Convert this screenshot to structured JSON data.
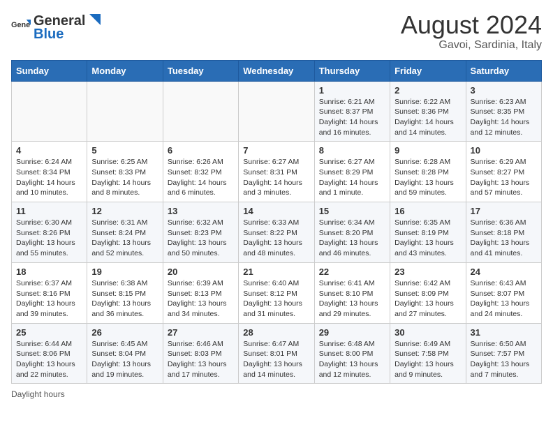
{
  "header": {
    "logo_general": "General",
    "logo_blue": "Blue",
    "main_title": "August 2024",
    "subtitle": "Gavoi, Sardinia, Italy"
  },
  "calendar": {
    "days_of_week": [
      "Sunday",
      "Monday",
      "Tuesday",
      "Wednesday",
      "Thursday",
      "Friday",
      "Saturday"
    ],
    "weeks": [
      [
        {
          "day": "",
          "info": ""
        },
        {
          "day": "",
          "info": ""
        },
        {
          "day": "",
          "info": ""
        },
        {
          "day": "",
          "info": ""
        },
        {
          "day": "1",
          "info": "Sunrise: 6:21 AM\nSunset: 8:37 PM\nDaylight: 14 hours and 16 minutes."
        },
        {
          "day": "2",
          "info": "Sunrise: 6:22 AM\nSunset: 8:36 PM\nDaylight: 14 hours and 14 minutes."
        },
        {
          "day": "3",
          "info": "Sunrise: 6:23 AM\nSunset: 8:35 PM\nDaylight: 14 hours and 12 minutes."
        }
      ],
      [
        {
          "day": "4",
          "info": "Sunrise: 6:24 AM\nSunset: 8:34 PM\nDaylight: 14 hours and 10 minutes."
        },
        {
          "day": "5",
          "info": "Sunrise: 6:25 AM\nSunset: 8:33 PM\nDaylight: 14 hours and 8 minutes."
        },
        {
          "day": "6",
          "info": "Sunrise: 6:26 AM\nSunset: 8:32 PM\nDaylight: 14 hours and 6 minutes."
        },
        {
          "day": "7",
          "info": "Sunrise: 6:27 AM\nSunset: 8:31 PM\nDaylight: 14 hours and 3 minutes."
        },
        {
          "day": "8",
          "info": "Sunrise: 6:27 AM\nSunset: 8:29 PM\nDaylight: 14 hours and 1 minute."
        },
        {
          "day": "9",
          "info": "Sunrise: 6:28 AM\nSunset: 8:28 PM\nDaylight: 13 hours and 59 minutes."
        },
        {
          "day": "10",
          "info": "Sunrise: 6:29 AM\nSunset: 8:27 PM\nDaylight: 13 hours and 57 minutes."
        }
      ],
      [
        {
          "day": "11",
          "info": "Sunrise: 6:30 AM\nSunset: 8:26 PM\nDaylight: 13 hours and 55 minutes."
        },
        {
          "day": "12",
          "info": "Sunrise: 6:31 AM\nSunset: 8:24 PM\nDaylight: 13 hours and 52 minutes."
        },
        {
          "day": "13",
          "info": "Sunrise: 6:32 AM\nSunset: 8:23 PM\nDaylight: 13 hours and 50 minutes."
        },
        {
          "day": "14",
          "info": "Sunrise: 6:33 AM\nSunset: 8:22 PM\nDaylight: 13 hours and 48 minutes."
        },
        {
          "day": "15",
          "info": "Sunrise: 6:34 AM\nSunset: 8:20 PM\nDaylight: 13 hours and 46 minutes."
        },
        {
          "day": "16",
          "info": "Sunrise: 6:35 AM\nSunset: 8:19 PM\nDaylight: 13 hours and 43 minutes."
        },
        {
          "day": "17",
          "info": "Sunrise: 6:36 AM\nSunset: 8:18 PM\nDaylight: 13 hours and 41 minutes."
        }
      ],
      [
        {
          "day": "18",
          "info": "Sunrise: 6:37 AM\nSunset: 8:16 PM\nDaylight: 13 hours and 39 minutes."
        },
        {
          "day": "19",
          "info": "Sunrise: 6:38 AM\nSunset: 8:15 PM\nDaylight: 13 hours and 36 minutes."
        },
        {
          "day": "20",
          "info": "Sunrise: 6:39 AM\nSunset: 8:13 PM\nDaylight: 13 hours and 34 minutes."
        },
        {
          "day": "21",
          "info": "Sunrise: 6:40 AM\nSunset: 8:12 PM\nDaylight: 13 hours and 31 minutes."
        },
        {
          "day": "22",
          "info": "Sunrise: 6:41 AM\nSunset: 8:10 PM\nDaylight: 13 hours and 29 minutes."
        },
        {
          "day": "23",
          "info": "Sunrise: 6:42 AM\nSunset: 8:09 PM\nDaylight: 13 hours and 27 minutes."
        },
        {
          "day": "24",
          "info": "Sunrise: 6:43 AM\nSunset: 8:07 PM\nDaylight: 13 hours and 24 minutes."
        }
      ],
      [
        {
          "day": "25",
          "info": "Sunrise: 6:44 AM\nSunset: 8:06 PM\nDaylight: 13 hours and 22 minutes."
        },
        {
          "day": "26",
          "info": "Sunrise: 6:45 AM\nSunset: 8:04 PM\nDaylight: 13 hours and 19 minutes."
        },
        {
          "day": "27",
          "info": "Sunrise: 6:46 AM\nSunset: 8:03 PM\nDaylight: 13 hours and 17 minutes."
        },
        {
          "day": "28",
          "info": "Sunrise: 6:47 AM\nSunset: 8:01 PM\nDaylight: 13 hours and 14 minutes."
        },
        {
          "day": "29",
          "info": "Sunrise: 6:48 AM\nSunset: 8:00 PM\nDaylight: 13 hours and 12 minutes."
        },
        {
          "day": "30",
          "info": "Sunrise: 6:49 AM\nSunset: 7:58 PM\nDaylight: 13 hours and 9 minutes."
        },
        {
          "day": "31",
          "info": "Sunrise: 6:50 AM\nSunset: 7:57 PM\nDaylight: 13 hours and 7 minutes."
        }
      ]
    ]
  },
  "footer": {
    "note": "Daylight hours"
  }
}
